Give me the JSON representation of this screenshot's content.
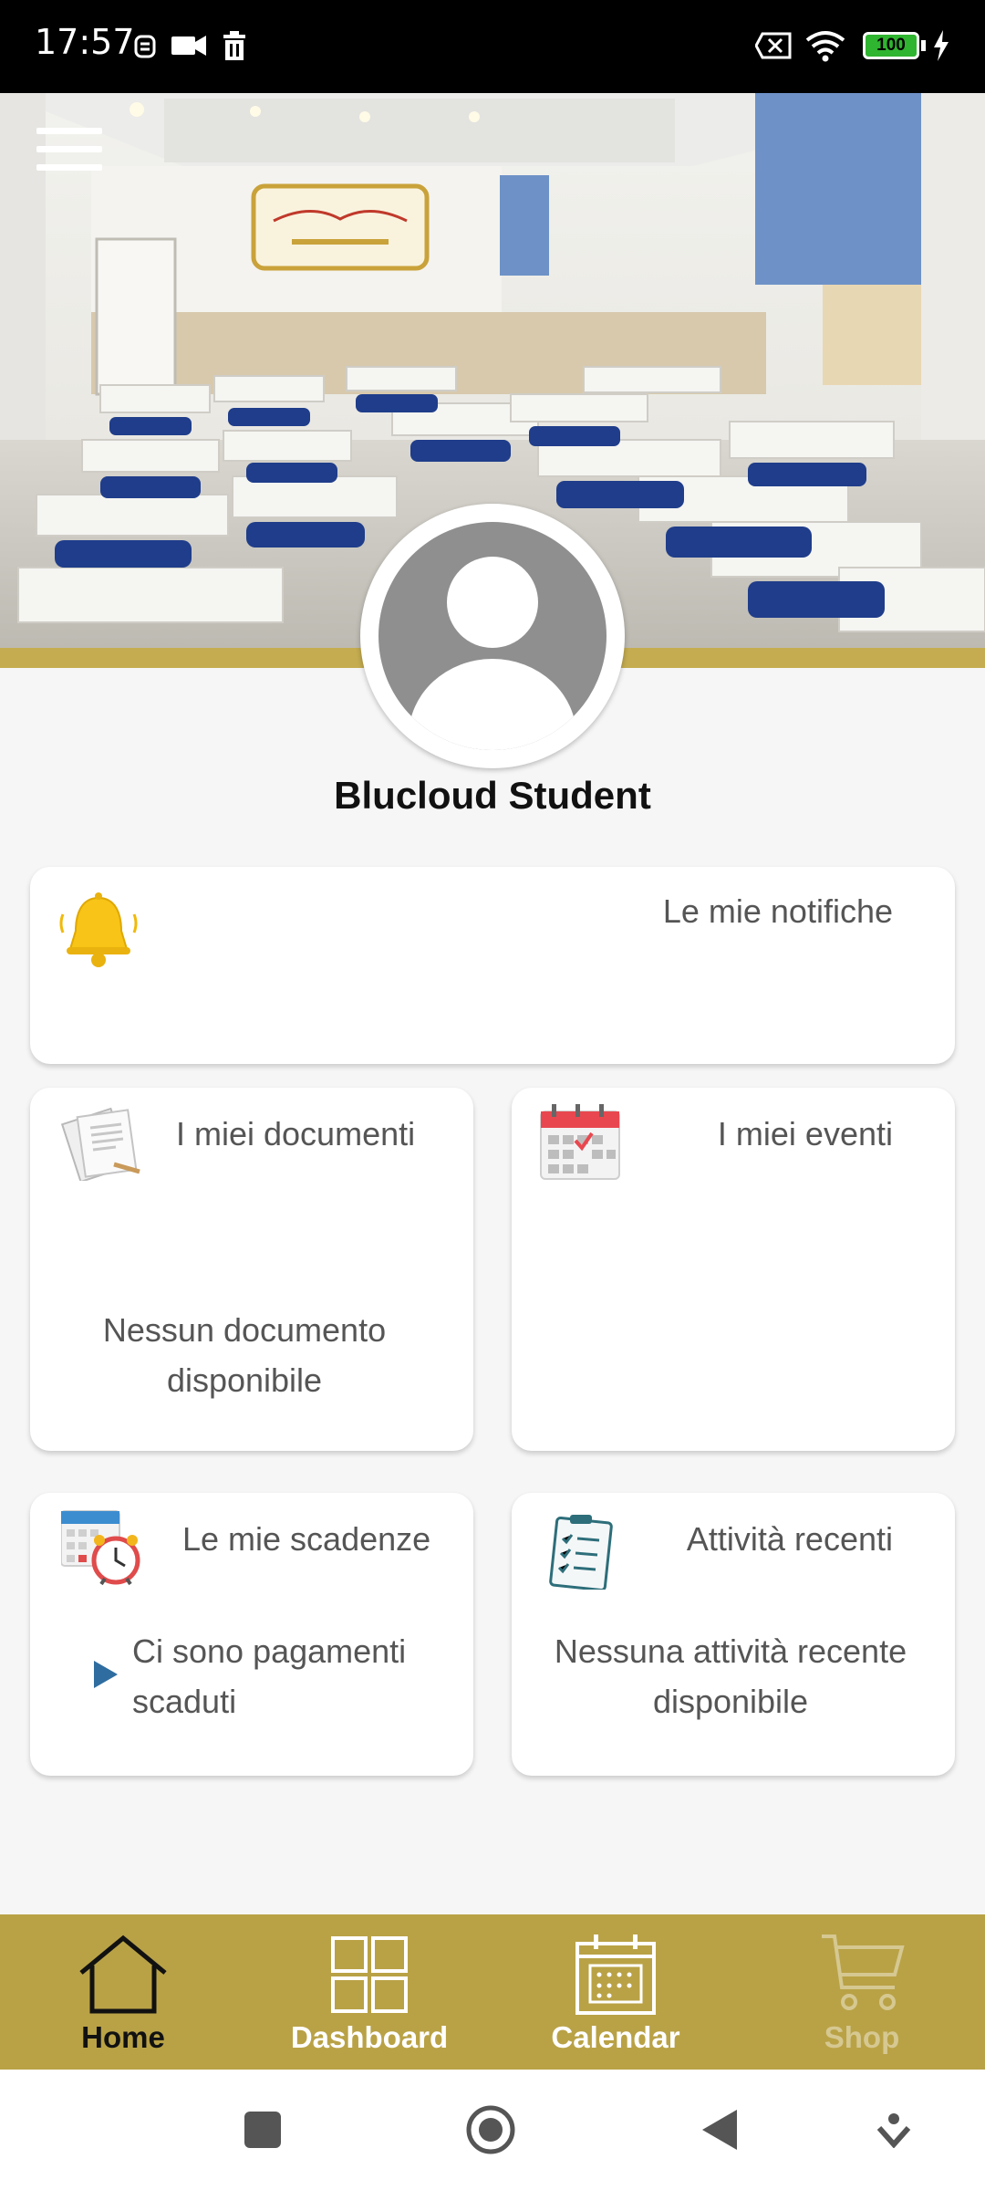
{
  "status_bar": {
    "time": "17:57",
    "battery": "100"
  },
  "profile": {
    "name": "Blucloud Student"
  },
  "cards": {
    "notifications": {
      "title": "Le mie notifiche"
    },
    "documents": {
      "title": "I miei documenti",
      "body": "Nessun documento disponibile"
    },
    "events": {
      "title": "I miei eventi"
    },
    "deadlines": {
      "title": "Le mie scadenze",
      "body": "Ci sono pagamenti scaduti"
    },
    "activities": {
      "title": "Attività recenti",
      "body": "Nessuna attività recente disponibile"
    }
  },
  "bottom_nav": {
    "items": [
      {
        "label": "Home",
        "icon": "home-icon",
        "active": true
      },
      {
        "label": "Dashboard",
        "icon": "grid-icon",
        "active": false
      },
      {
        "label": "Calendar",
        "icon": "calendar-icon",
        "active": false
      },
      {
        "label": "Shop",
        "icon": "cart-icon",
        "active": false,
        "disabled": true
      }
    ]
  },
  "colors": {
    "gold": "#c5ac50",
    "nav_gold": "#b9a246",
    "blue_arrow": "#2f6da0"
  }
}
